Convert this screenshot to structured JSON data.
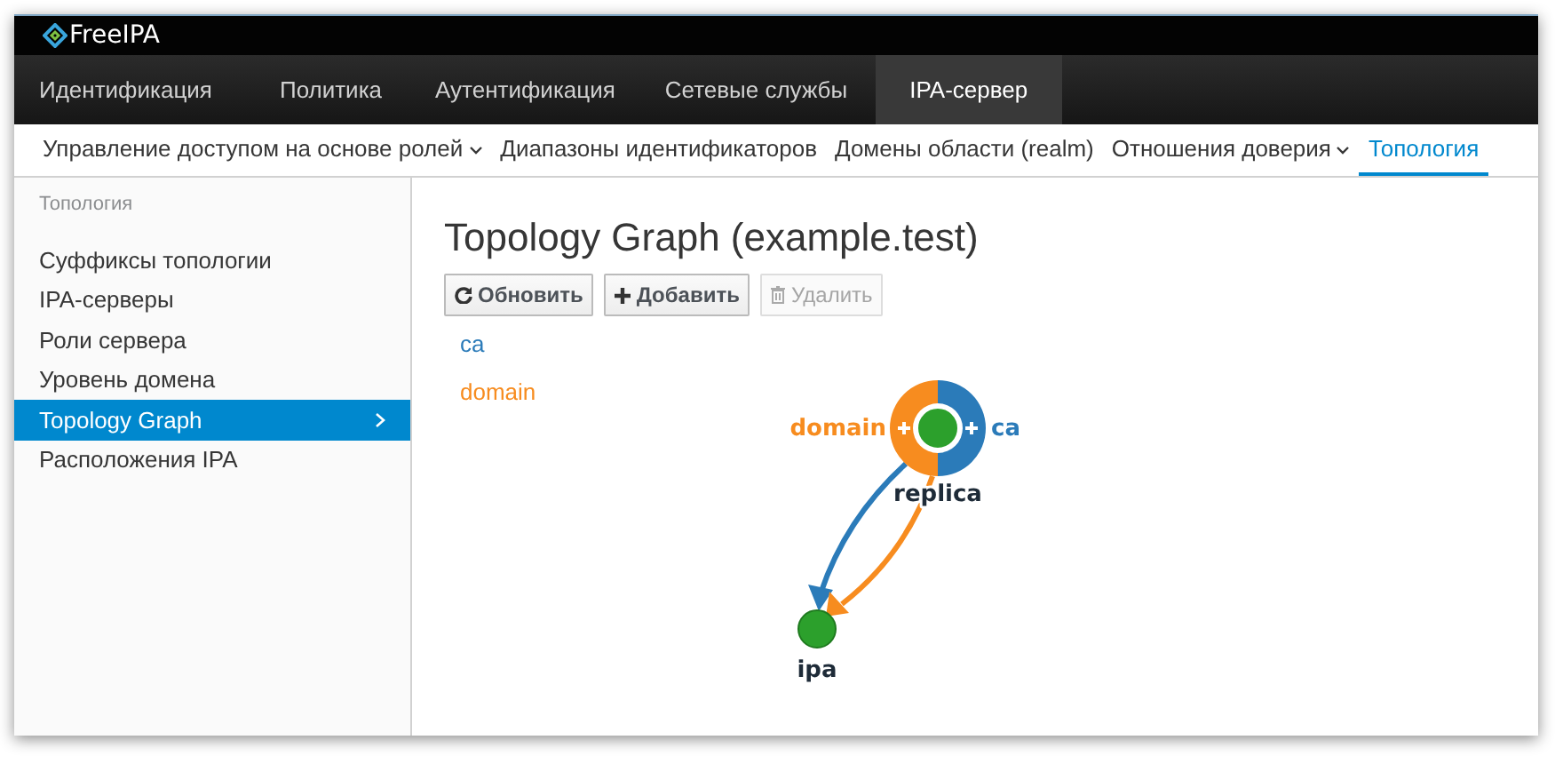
{
  "brand": "FreeIPA",
  "nav": [
    {
      "label": "Идентификация",
      "selected": false
    },
    {
      "label": "Политика",
      "selected": false
    },
    {
      "label": "Аутентификация",
      "selected": false
    },
    {
      "label": "Сетевые службы",
      "selected": false
    },
    {
      "label": "IPA-сервер",
      "selected": true
    }
  ],
  "subnav": [
    {
      "label": "Управление доступом на основе ролей",
      "dropdown": true,
      "selected": false
    },
    {
      "label": "Диапазоны идентификаторов",
      "dropdown": false,
      "selected": false
    },
    {
      "label": "Домены области (realm)",
      "dropdown": false,
      "selected": false
    },
    {
      "label": "Отношения доверия",
      "dropdown": true,
      "selected": false
    },
    {
      "label": "Топология",
      "dropdown": false,
      "selected": true
    }
  ],
  "sidebar": {
    "heading": "Топология",
    "items": [
      {
        "label": "Суффиксы топологии",
        "selected": false
      },
      {
        "label": "IPA-серверы",
        "selected": false
      },
      {
        "label": "Роли сервера",
        "selected": false
      },
      {
        "label": "Уровень домена",
        "selected": false
      },
      {
        "label": "Topology Graph",
        "selected": true
      },
      {
        "label": "Расположения IPA",
        "selected": false
      }
    ]
  },
  "title": "Topology Graph (example.test)",
  "buttons": [
    {
      "label": "Обновить",
      "kind": "refresh",
      "disabled": false
    },
    {
      "label": "Добавить",
      "kind": "add",
      "disabled": false
    },
    {
      "label": "Удалить",
      "kind": "delete",
      "disabled": true
    }
  ],
  "graph": {
    "legend": [
      {
        "label": "ca",
        "color": "#2b7bb9"
      },
      {
        "label": "domain",
        "color": "#f78c1f"
      }
    ],
    "nodes": [
      {
        "label": "replica",
        "ring": [
          {
            "label": "domain",
            "color": "#f78c1f"
          },
          {
            "label": "ca",
            "color": "#2b7bb9"
          }
        ]
      },
      {
        "label": "ipa"
      }
    ],
    "edges": [
      {
        "color": "#2b7bb9"
      },
      {
        "color": "#f78c1f"
      }
    ]
  }
}
